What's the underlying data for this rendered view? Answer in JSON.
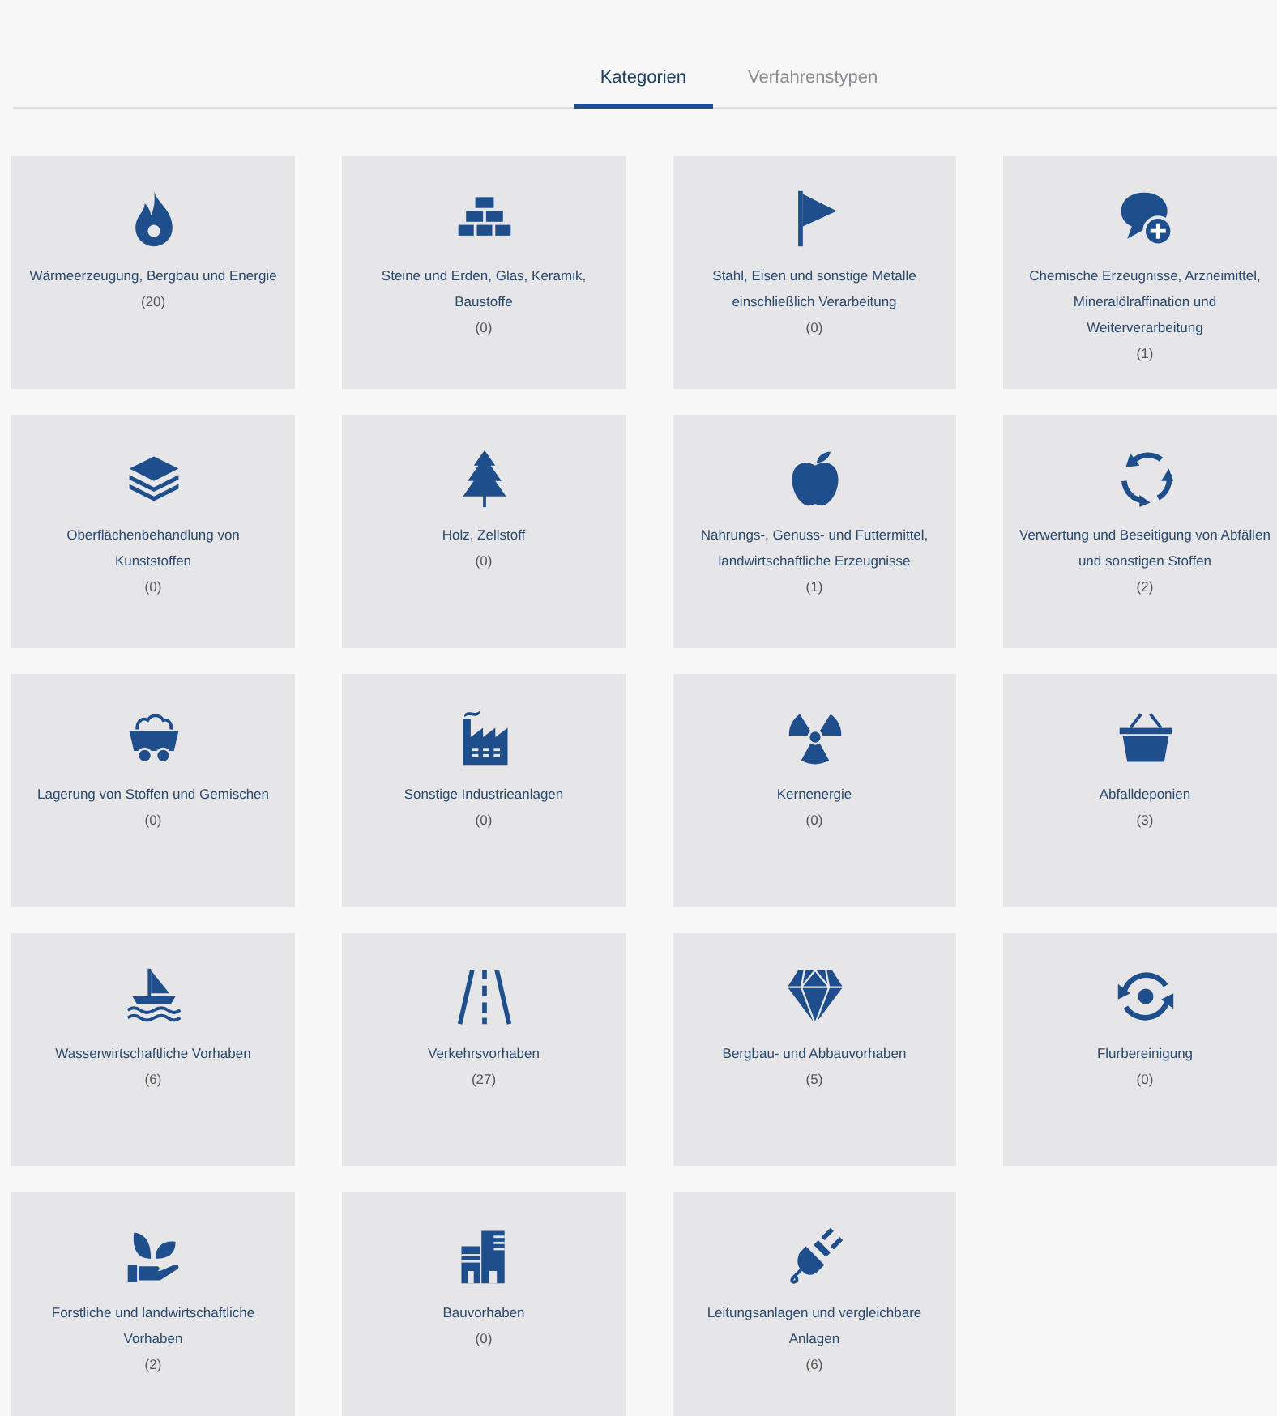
{
  "tabs": [
    {
      "label": "Kategorien",
      "selected": true
    },
    {
      "label": "Verfahrenstypen",
      "selected": false
    }
  ],
  "categories": [
    {
      "kind": "flame",
      "label": "Wärmeerzeugung, Bergbau und Energie",
      "count": "(20)"
    },
    {
      "kind": "bricks",
      "label": "Steine und Erden, Glas, Keramik, Baustoffe",
      "count": "(0)"
    },
    {
      "kind": "flag",
      "label": "Stahl, Eisen und sonstige Metalle einschließlich Verarbeitung",
      "count": "(0)"
    },
    {
      "kind": "chat",
      "label": "Chemische Erzeugnisse, Arzneimittel, Mineralölraffination und Weiterverarbeitung",
      "count": "(1)"
    },
    {
      "kind": "layers",
      "label": "Oberflächenbehandlung von Kunststoffen",
      "count": "(0)"
    },
    {
      "kind": "tree",
      "label": "Holz, Zellstoff",
      "count": "(0)"
    },
    {
      "kind": "apple",
      "label": "Nahrungs-, Genuss- und Futtermittel, landwirtschaftliche Erzeugnisse",
      "count": "(1)"
    },
    {
      "kind": "recycle",
      "label": "Verwertung und Beseitigung von Abfällen und sonstigen Stoffen",
      "count": "(2)"
    },
    {
      "kind": "cart",
      "label": "Lagerung von Stoffen und Gemischen",
      "count": "(0)"
    },
    {
      "kind": "factory",
      "label": "Sonstige Industrieanlagen",
      "count": "(0)"
    },
    {
      "kind": "radiation",
      "label": "Kernenergie",
      "count": "(0)"
    },
    {
      "kind": "basket",
      "label": "Abfalldeponien",
      "count": "(3)"
    },
    {
      "kind": "boat",
      "label": "Wasserwirtschaftliche Vorhaben",
      "count": "(6)"
    },
    {
      "kind": "road",
      "label": "Verkehrsvorhaben",
      "count": "(27)"
    },
    {
      "kind": "diamond",
      "label": "Bergbau- und Abbauvorhaben",
      "count": "(5)"
    },
    {
      "kind": "rotate",
      "label": "Flurbereinigung",
      "count": "(0)"
    },
    {
      "kind": "plant",
      "label": "Forstliche und landwirtschaftliche Vorhaben",
      "count": "(2)"
    },
    {
      "kind": "buildings",
      "label": "Bauvorhaben",
      "count": "(0)"
    },
    {
      "kind": "plug",
      "label": "Leitungsanlagen und vergleichbare Anlagen",
      "count": "(6)"
    }
  ]
}
